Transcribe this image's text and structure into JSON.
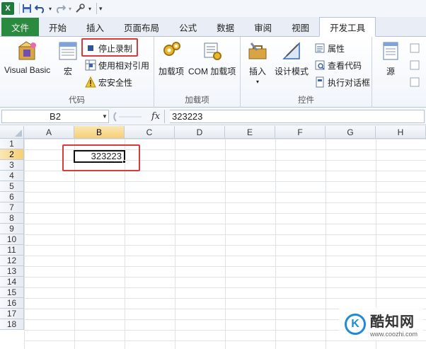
{
  "quick_access": {
    "app_logo": "X",
    "icons": [
      "save-icon",
      "undo-icon",
      "redo-icon",
      "customize-icon"
    ]
  },
  "tabs": [
    {
      "label": "文件",
      "name": "tab-file"
    },
    {
      "label": "开始",
      "name": "tab-home"
    },
    {
      "label": "插入",
      "name": "tab-insert"
    },
    {
      "label": "页面布局",
      "name": "tab-page-layout"
    },
    {
      "label": "公式",
      "name": "tab-formulas"
    },
    {
      "label": "数据",
      "name": "tab-data"
    },
    {
      "label": "审阅",
      "name": "tab-review"
    },
    {
      "label": "视图",
      "name": "tab-view"
    },
    {
      "label": "开发工具",
      "name": "tab-developer"
    }
  ],
  "ribbon": {
    "code_group": {
      "label": "代码",
      "visual_basic": "Visual Basic",
      "macros": "宏",
      "stop_recording": "停止录制",
      "relative_refs": "使用相对引用",
      "macro_security": "宏安全性"
    },
    "addins_group": {
      "label": "加载项",
      "addins": "加载项",
      "com_addins": "COM 加载项"
    },
    "controls_group": {
      "label": "控件",
      "insert": "插入",
      "design_mode": "设计模式",
      "properties": "属性",
      "view_code": "查看代码",
      "run_dialog": "执行对话框"
    },
    "xml_group": {
      "source": "源"
    }
  },
  "formula_bar": {
    "name_box": "B2",
    "fx": "fx",
    "value": "323223"
  },
  "sheet": {
    "columns": [
      "A",
      "B",
      "C",
      "D",
      "E",
      "F",
      "G",
      "H"
    ],
    "rows": [
      "1",
      "2",
      "3",
      "4",
      "5",
      "6",
      "7",
      "8",
      "9",
      "10",
      "11",
      "12",
      "13",
      "14",
      "15",
      "16",
      "17",
      "18"
    ],
    "active_cell_value": "323223",
    "selected_column": "B",
    "selected_row": "2"
  },
  "watermark": {
    "logo_letter": "K",
    "title": "酷知网",
    "url": "www.coozhi.com"
  },
  "colors": {
    "file_tab": "#2a8a3e",
    "highlight": "#d93a3a",
    "header_selected": "#f6cf72"
  }
}
